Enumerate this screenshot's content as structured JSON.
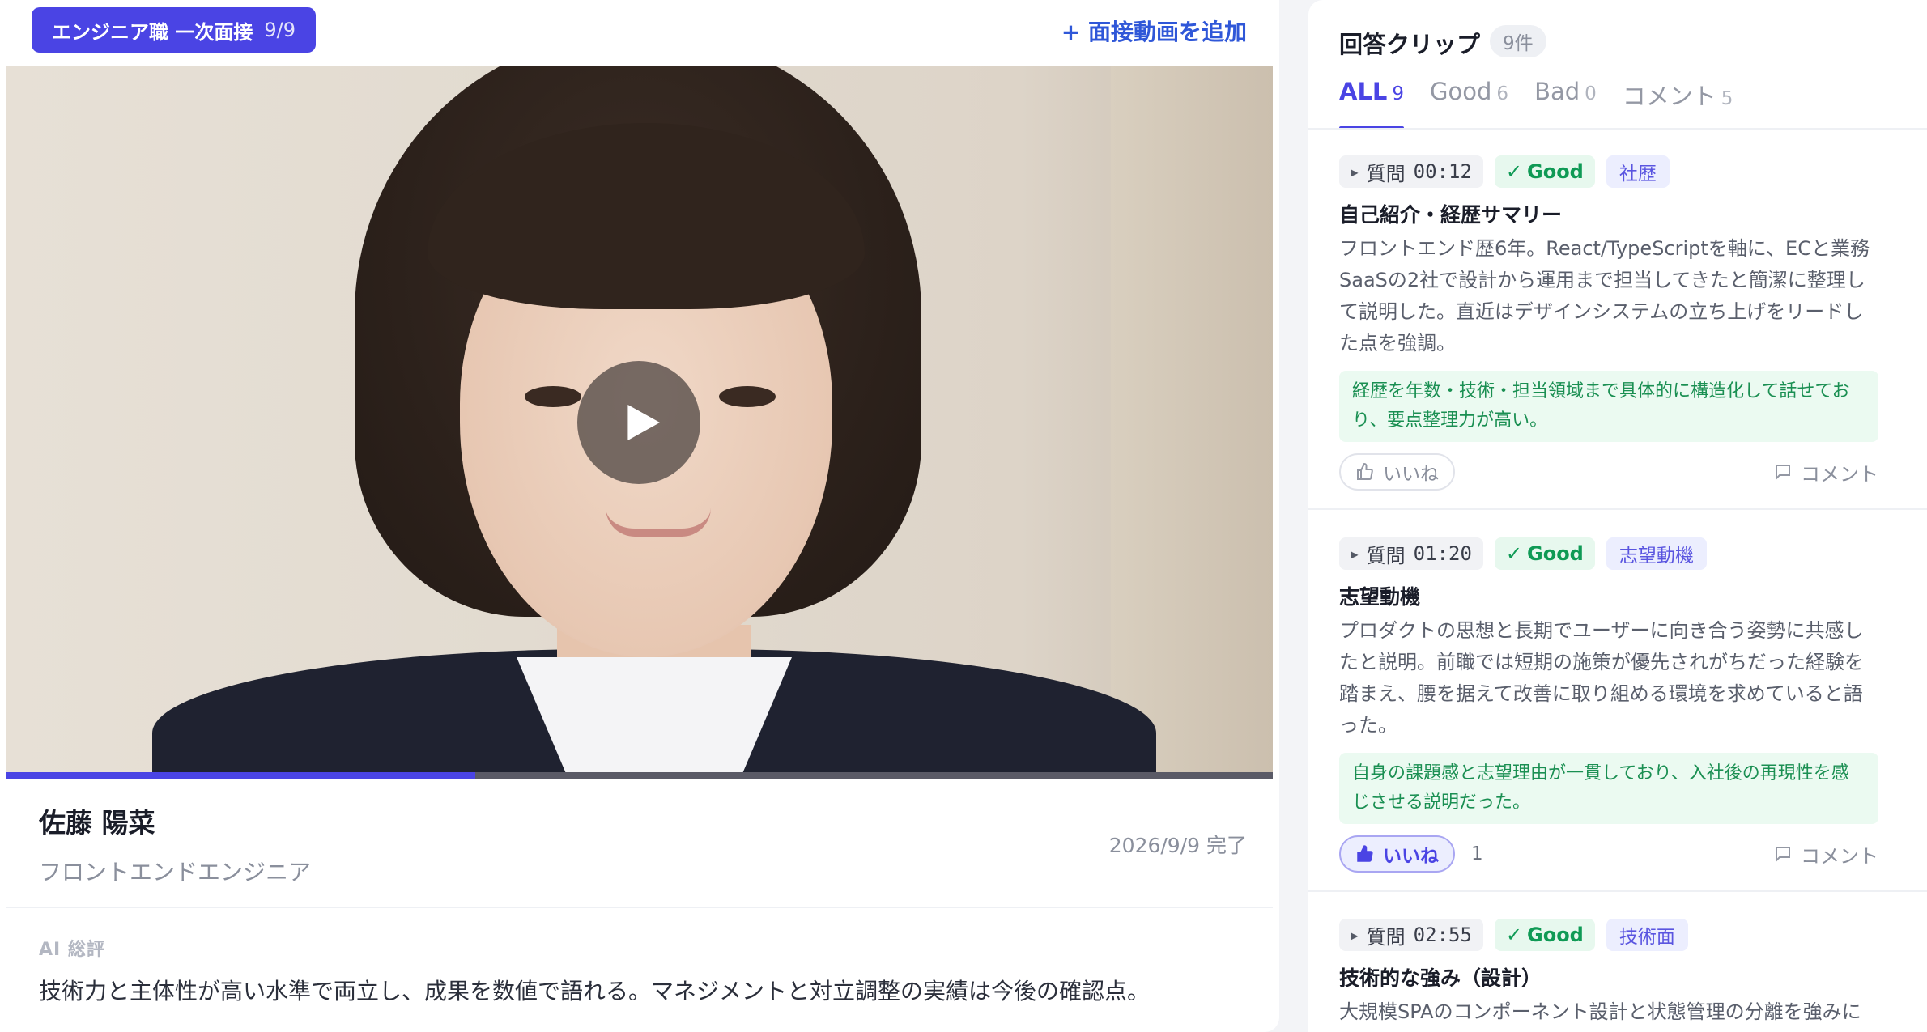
{
  "session": {
    "label": "エンジニア職 一次面接",
    "count": "9/9"
  },
  "add_video_label": "+ 面接動画を追加",
  "video": {
    "progress": 0.37
  },
  "candidate": {
    "name": "佐藤 陽菜",
    "role": "フロントエンドエンジニア",
    "completed": "2026/9/9 完了"
  },
  "ai_summary": {
    "label": "AI 総評",
    "text": "技術力と主体性が高い水準で両立し、成果を数値で語れる。マネジメントと対立調整の実績は今後の確認点。"
  },
  "clips_panel": {
    "title": "回答クリップ",
    "count": "9件",
    "tabs": [
      {
        "label": "ALL",
        "count": "9"
      },
      {
        "label": "Good",
        "count": "6"
      },
      {
        "label": "Bad",
        "count": "0"
      },
      {
        "label": "コメント",
        "count": "5"
      }
    ],
    "like_label": "いいね",
    "comment_label": "コメント",
    "clips": [
      {
        "question": "質問",
        "time": "00:12",
        "rating": "Good",
        "tag": "社歴",
        "title": "自己紹介・経歴サマリー",
        "body": "フロントエンド歴6年。React/TypeScriptを軸に、ECと業務SaaSの2社で設計から運用まで担当してきたと簡潔に整理して説明した。直近はデザインシステムの立ち上げをリードした点を強調。",
        "note": "経歴を年数・技術・担当領域まで具体的に構造化して話せており、要点整理力が高い。",
        "liked": false,
        "likes": ""
      },
      {
        "question": "質問",
        "time": "01:20",
        "rating": "Good",
        "tag": "志望動機",
        "title": "志望動機",
        "body": "プロダクトの思想と長期でユーザーに向き合う姿勢に共感したと説明。前職では短期の施策が優先されがちだった経験を踏まえ、腰を据えて改善に取り組める環境を求めていると語った。",
        "note": "自身の課題感と志望理由が一貫しており、入社後の再現性を感じさせる説明だった。",
        "liked": true,
        "likes": "1"
      },
      {
        "question": "質問",
        "time": "02:55",
        "rating": "Good",
        "tag": "技術面",
        "title": "技術的な強み（設計）",
        "body": "大規模SPAのコンポーネント設計と状態管理の分離を強みに"
      }
    ]
  }
}
